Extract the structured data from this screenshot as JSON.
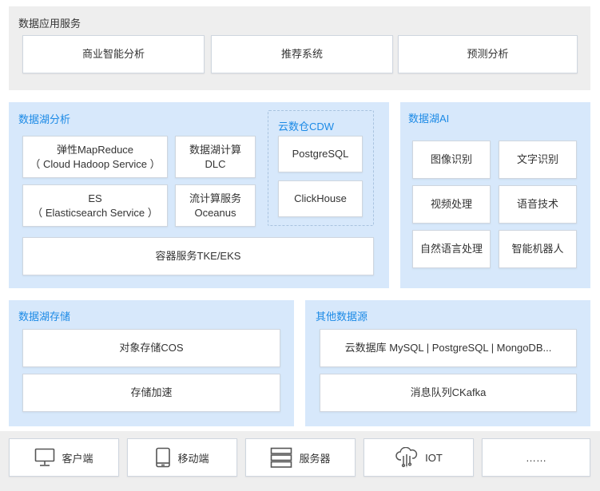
{
  "app_services": {
    "title": "数据应用服务",
    "items": [
      "商业智能分析",
      "推荐系统",
      "预测分析"
    ]
  },
  "lake_analysis": {
    "title": "数据湖分析",
    "emr": {
      "line1": "弹性MapReduce",
      "line2": "（ Cloud Hadoop Service ）"
    },
    "dlc": {
      "line1": "数据湖计算",
      "line2": "DLC"
    },
    "es": {
      "line1": "ES",
      "line2": "（ Elasticsearch Service ）"
    },
    "oceanus": {
      "line1": "流计算服务",
      "line2": "Oceanus"
    },
    "container": "容器服务TKE/EKS",
    "cdw": {
      "title": "云数仓CDW",
      "items": [
        "PostgreSQL",
        "ClickHouse"
      ]
    }
  },
  "lake_ai": {
    "title": "数据湖AI",
    "items": [
      "图像识别",
      "文字识别",
      "视频处理",
      "语音技术",
      "自然语言处理",
      "智能机器人"
    ]
  },
  "lake_storage": {
    "title": "数据湖存储",
    "items": [
      "对象存储COS",
      "存储加速"
    ]
  },
  "other_sources": {
    "title": "其他数据源",
    "items": [
      "云数据库 MySQL | PostgreSQL | MongoDB...",
      "消息队列CKafka"
    ]
  },
  "clients": {
    "items": [
      {
        "label": "客户端",
        "icon": "monitor-icon"
      },
      {
        "label": "移动端",
        "icon": "mobile-icon"
      },
      {
        "label": "服务器",
        "icon": "server-icon"
      },
      {
        "label": "IOT",
        "icon": "cloud-iot-icon"
      },
      {
        "label": "……",
        "icon": ""
      }
    ]
  },
  "colors": {
    "accent_blue": "#1c8ae6",
    "panel_blue": "#d7e8fb",
    "panel_gray": "#eeeeee"
  }
}
